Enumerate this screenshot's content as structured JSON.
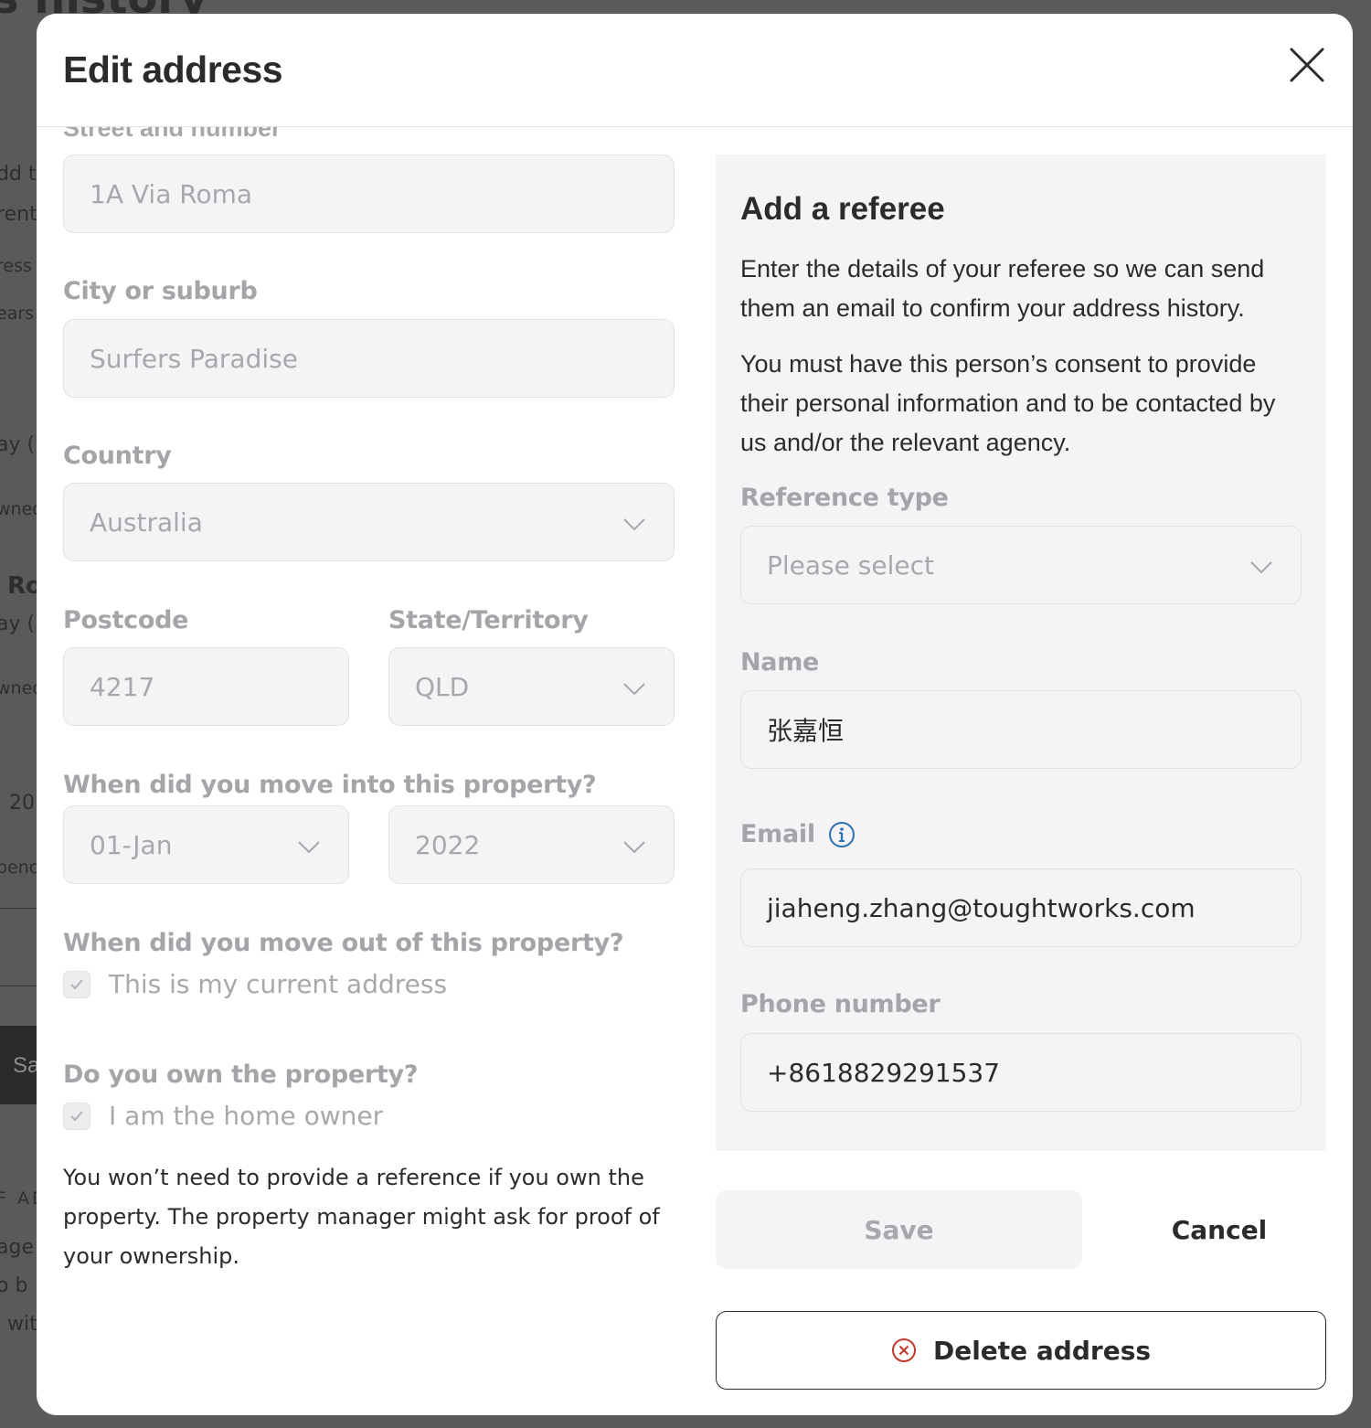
{
  "background": {
    "title_fragment": "s history",
    "fragments": [
      "dd t",
      "rent",
      "ress",
      "ears",
      "ay (",
      "wned",
      "Ro",
      "ay (",
      "wned",
      "20",
      "penc",
      "Sa",
      "F AD",
      "age",
      "o b",
      "wit"
    ]
  },
  "modal": {
    "title": "Edit address",
    "close_icon": "close-icon"
  },
  "address": {
    "street_label": "Street and number",
    "street_value": "1A Via Roma",
    "city_label": "City or suburb",
    "city_value": "Surfers Paradise",
    "country_label": "Country",
    "country_value": "Australia",
    "postcode_label": "Postcode",
    "postcode_value": "4217",
    "state_label": "State/Territory",
    "state_value": "QLD",
    "move_in_label": "When did you move into this property?",
    "move_in_day": "01-Jan",
    "move_in_year": "2022",
    "move_out_label": "When did you move out of this property?",
    "current_address_label": "This is my current address",
    "current_address_checked": true,
    "own_label": "Do you own the property?",
    "home_owner_label": "I am the home owner",
    "home_owner_checked": true,
    "note": "You won’t need to provide a reference if you own the property. The property manager might ask for proof of your ownership."
  },
  "referee": {
    "title": "Add a referee",
    "para1": "Enter the details of your referee so we can send them an email to confirm your address history.",
    "para2": "You must have this person’s consent to provide their personal information and to be contacted by us and/or the relevant agency.",
    "type_label": "Reference type",
    "type_placeholder": "Please select",
    "name_label": "Name",
    "name_value": "张嘉恒",
    "email_label": "Email",
    "email_value": "jiaheng.zhang@toughtworks.com",
    "phone_label": "Phone number",
    "phone_value": "+8618829291537"
  },
  "actions": {
    "save_label": "Save",
    "cancel_label": "Cancel",
    "delete_label": "Delete address"
  },
  "colors": {
    "delete_icon": "#c0392b",
    "info_icon": "#2f6fb3",
    "disabled_text": "#a8a8ac"
  }
}
